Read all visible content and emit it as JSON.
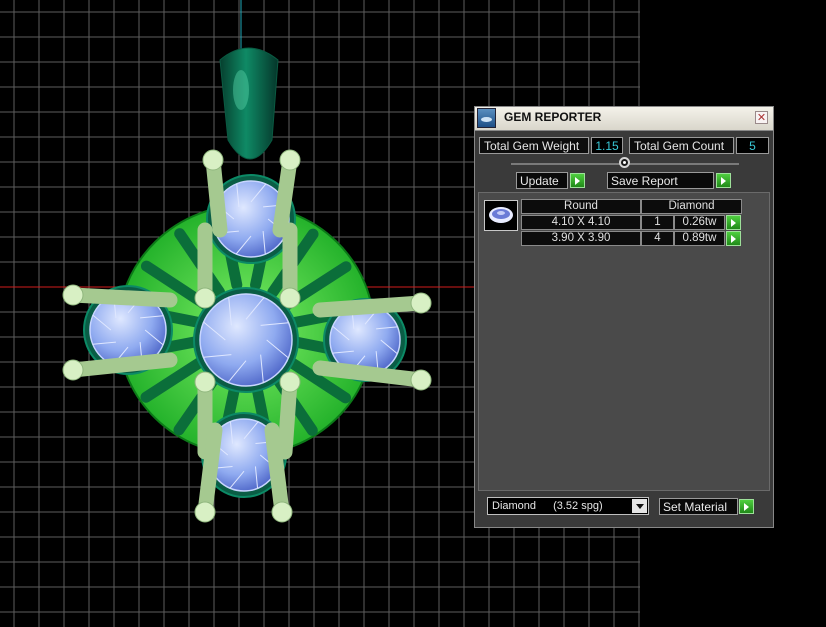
{
  "panel": {
    "title": "GEM REPORTER",
    "close_glyph": "✕",
    "total_gem_weight_label": "Total Gem Weight",
    "total_gem_weight_value": "1.15",
    "total_gem_count_label": "Total Gem Count",
    "total_gem_count_value": "5",
    "update_label": "Update",
    "save_report_label": "Save Report",
    "table": {
      "header_shape": "Round",
      "header_material": "Diamond",
      "rows": [
        {
          "size": "4.10 X 4.10",
          "count": "1",
          "weight": "0.26tw"
        },
        {
          "size": "3.90 X 3.90",
          "count": "4",
          "weight": "0.89tw"
        }
      ]
    },
    "material_select": {
      "name": "Diamond",
      "density": "(3.52 spg)"
    },
    "set_material_label": "Set Material"
  },
  "icons": {
    "title": "gem-reporter-app-icon",
    "close": "close-icon",
    "play": "play-arrow-icon",
    "gem": "round-gem-icon",
    "dropdown": "chevron-down-icon"
  },
  "colors": {
    "viewport_bg": "#000000",
    "grid": "#6e6e6e",
    "metal": "#2fc43a",
    "bail": "#0a6f52",
    "prongs": "#c7e3b3",
    "gem": "#8faaf0",
    "value_text": "#39c9d8",
    "axis_x": "#d11c1c",
    "axis_y": "#1fa9b8"
  }
}
